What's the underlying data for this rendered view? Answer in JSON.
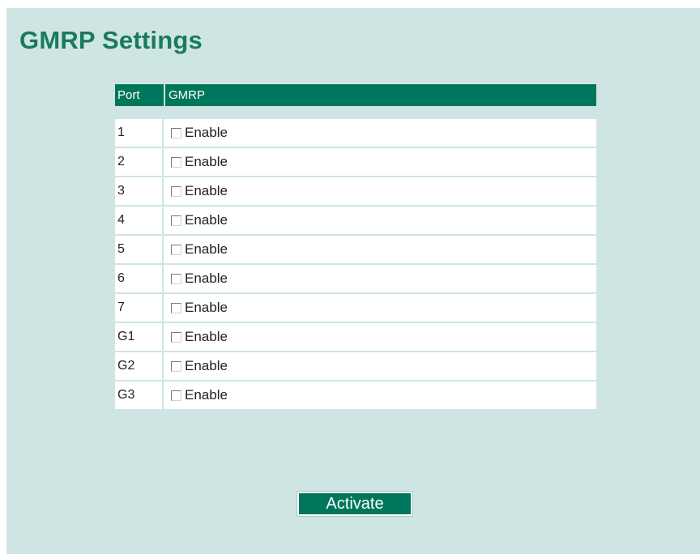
{
  "page": {
    "title": "GMRP Settings"
  },
  "table": {
    "headers": {
      "port": "Port",
      "gmrp": "GMRP"
    },
    "rows": [
      {
        "port": "1",
        "label": "Enable",
        "checked": false
      },
      {
        "port": "2",
        "label": "Enable",
        "checked": false
      },
      {
        "port": "3",
        "label": "Enable",
        "checked": false
      },
      {
        "port": "4",
        "label": "Enable",
        "checked": false
      },
      {
        "port": "5",
        "label": "Enable",
        "checked": false
      },
      {
        "port": "6",
        "label": "Enable",
        "checked": false
      },
      {
        "port": "7",
        "label": "Enable",
        "checked": false
      },
      {
        "port": "G1",
        "label": "Enable",
        "checked": false
      },
      {
        "port": "G2",
        "label": "Enable",
        "checked": false
      },
      {
        "port": "G3",
        "label": "Enable",
        "checked": false
      }
    ]
  },
  "actions": {
    "activate_label": "Activate"
  },
  "colors": {
    "background": "#cfe5e3",
    "accent": "#00775c",
    "title": "#1a7a60"
  }
}
